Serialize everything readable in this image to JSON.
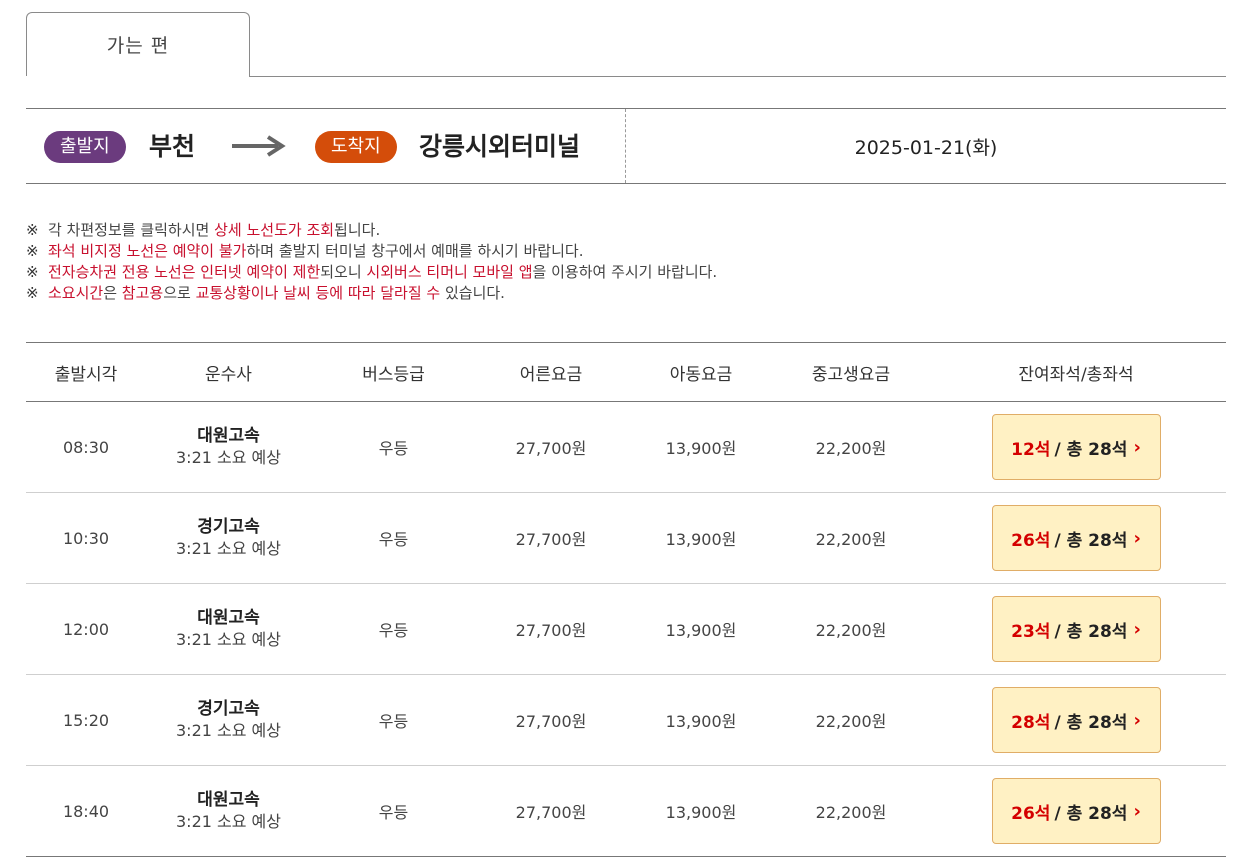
{
  "tabs": [
    {
      "label": "가는 편",
      "active": true
    }
  ],
  "route": {
    "departure_label": "출발지",
    "departure_name": "부천",
    "arrival_label": "도착지",
    "arrival_name": "강릉시외터미널",
    "date": "2025-01-21(화)"
  },
  "colors": {
    "departure_pill": "#6b3b7e",
    "arrival_pill": "#d44d0a",
    "highlight": "#c8102e",
    "seat_button_bg": "#fff1c4"
  },
  "notices": [
    [
      {
        "t": "각 차편정보를 클릭하시면 "
      },
      {
        "t": "상세 노선도가 조회",
        "hl": true
      },
      {
        "t": "됩니다."
      }
    ],
    [
      {
        "t": "좌석 비지정 노선은 예약이 불가",
        "hl": true
      },
      {
        "t": "하며 출발지 터미널 창구에서 예매를 하시기 바랍니다."
      }
    ],
    [
      {
        "t": "전자승차권 전용 노선은 인터넷 예약이 제한",
        "hl": true
      },
      {
        "t": "되오니 "
      },
      {
        "t": "시외버스 티머니 모바일 앱",
        "hl": true
      },
      {
        "t": "을 이용하여 주시기 바랍니다."
      }
    ],
    [
      {
        "t": "소요시간",
        "hl": true
      },
      {
        "t": "은 "
      },
      {
        "t": "참고용",
        "hl": true
      },
      {
        "t": "으로 "
      },
      {
        "t": "교통상황이나 날씨 등에 따라 달라질 수",
        "hl": true
      },
      {
        "t": " 있습니다."
      }
    ]
  ],
  "notice_mark": "※",
  "table": {
    "headers": [
      "출발시각",
      "운수사",
      "버스등급",
      "어른요금",
      "아동요금",
      "중고생요금",
      "잔여좌석/총좌석"
    ],
    "rows": [
      {
        "time": "08:30",
        "company": "대원고속",
        "duration": "3:21 소요 예상",
        "grade": "우등",
        "adult": "27,700원",
        "child": "13,900원",
        "teen": "22,200원",
        "remaining": "12석",
        "total": "/ 총 28석"
      },
      {
        "time": "10:30",
        "company": "경기고속",
        "duration": "3:21 소요 예상",
        "grade": "우등",
        "adult": "27,700원",
        "child": "13,900원",
        "teen": "22,200원",
        "remaining": "26석",
        "total": "/ 총 28석"
      },
      {
        "time": "12:00",
        "company": "대원고속",
        "duration": "3:21 소요 예상",
        "grade": "우등",
        "adult": "27,700원",
        "child": "13,900원",
        "teen": "22,200원",
        "remaining": "23석",
        "total": "/ 총 28석"
      },
      {
        "time": "15:20",
        "company": "경기고속",
        "duration": "3:21 소요 예상",
        "grade": "우등",
        "adult": "27,700원",
        "child": "13,900원",
        "teen": "22,200원",
        "remaining": "28석",
        "total": "/ 총 28석"
      },
      {
        "time": "18:40",
        "company": "대원고속",
        "duration": "3:21 소요 예상",
        "grade": "우등",
        "adult": "27,700원",
        "child": "13,900원",
        "teen": "22,200원",
        "remaining": "26석",
        "total": "/ 총 28석"
      }
    ]
  }
}
